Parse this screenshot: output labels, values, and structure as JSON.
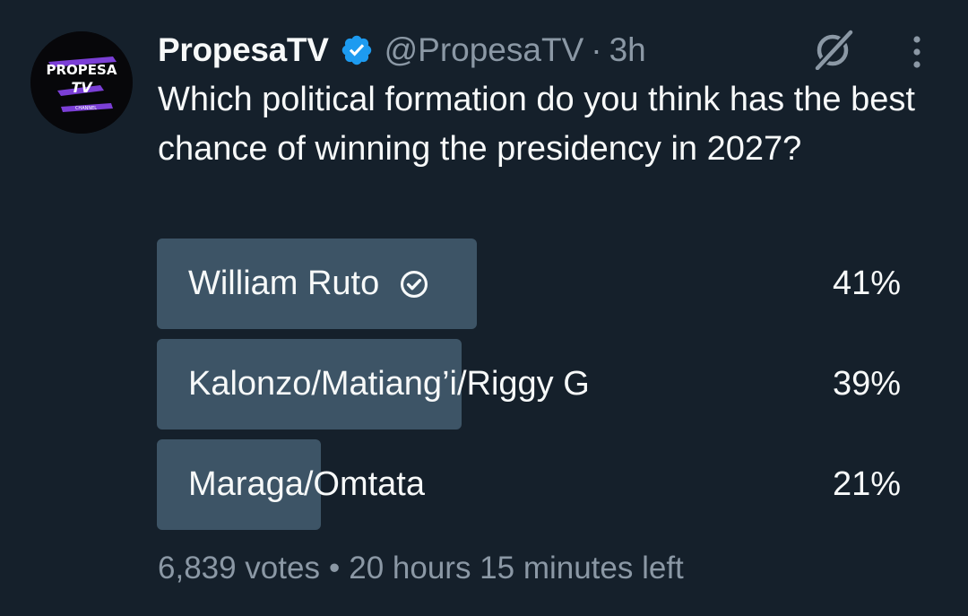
{
  "tweet": {
    "avatar": {
      "brand_text_top": "PROPESA",
      "brand_text_mid": "TV",
      "brand_text_bottom": "CHANNEL"
    },
    "display_name": "PropesaTV",
    "handle": "@PropesaTV",
    "separator": "·",
    "time": "3h",
    "question": "Which political formation do you think has the best chance of winning the presidency in 2027?"
  },
  "poll": {
    "options": [
      {
        "label": "William Ruto",
        "percent_text": "41%",
        "percent": 41,
        "selected": true
      },
      {
        "label": "Kalonzo/Matiang’i/Riggy G",
        "percent_text": "39%",
        "percent": 39,
        "selected": false
      },
      {
        "label": "Maraga/Omtata",
        "percent_text": "21%",
        "percent": 21,
        "selected": false
      }
    ],
    "votes": "6,839 votes",
    "separator": "•",
    "time_left": "20 hours 15 minutes left"
  },
  "colors": {
    "background": "#15202b",
    "bar": "#3d5466",
    "verified": "#1d9bf0",
    "muted_text": "#8b98a5",
    "avatar_accent": "#7b3fd6"
  },
  "icons": {
    "verified": "verified-badge-icon",
    "grok": "grok-icon",
    "more": "more-vertical-icon",
    "selected": "check-circle-icon"
  }
}
